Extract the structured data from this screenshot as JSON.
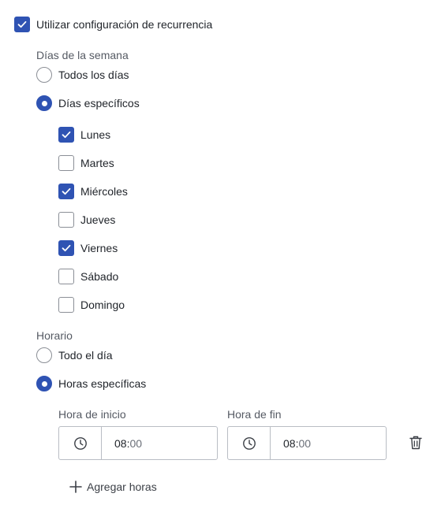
{
  "recurrence": {
    "label": "Utilizar configuración de recurrencia",
    "checked": true
  },
  "weekdays": {
    "title": "Días de la semana",
    "options": [
      {
        "label": "Todos los días",
        "selected": false
      },
      {
        "label": "Días específicos",
        "selected": true
      }
    ],
    "days": [
      {
        "label": "Lunes",
        "checked": true
      },
      {
        "label": "Martes",
        "checked": false
      },
      {
        "label": "Miércoles",
        "checked": true
      },
      {
        "label": "Jueves",
        "checked": false
      },
      {
        "label": "Viernes",
        "checked": true
      },
      {
        "label": "Sábado",
        "checked": false
      },
      {
        "label": "Domingo",
        "checked": false
      }
    ]
  },
  "schedule": {
    "title": "Horario",
    "options": [
      {
        "label": "Todo el día",
        "selected": false
      },
      {
        "label": "Horas específicas",
        "selected": true
      }
    ],
    "start": {
      "label": "Hora de inicio",
      "hours": "08",
      "sep": ":",
      "minutes": "00"
    },
    "end": {
      "label": "Hora de fin",
      "hours": "08",
      "sep": ":",
      "minutes": "00"
    },
    "add_label": "Agregar horas"
  },
  "colors": {
    "accent": "#2f53b3",
    "border": "#b9bdc4",
    "text": "#1f2329",
    "muted": "#555a63"
  },
  "icons": {
    "check": "check-icon",
    "clock": "clock-icon",
    "trash": "trash-icon",
    "plus": "plus-icon"
  }
}
